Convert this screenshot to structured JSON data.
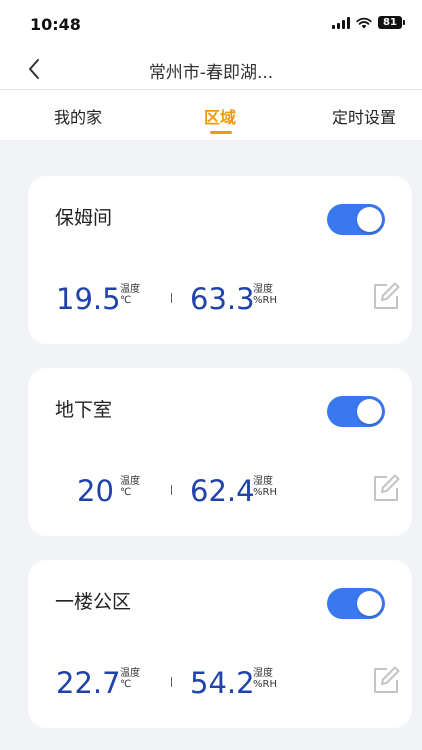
{
  "status_bar": {
    "time": "10:48",
    "battery": "81"
  },
  "nav": {
    "title": "常州市-春即湖..."
  },
  "tabs": [
    {
      "label": "我的家",
      "active": false
    },
    {
      "label": "区域",
      "active": true
    },
    {
      "label": "定时设置",
      "active": false
    }
  ],
  "colors": {
    "accent_orange": "#f29a0e",
    "toggle_blue": "#3a78ef",
    "value_blue": "#1f43a8"
  },
  "rooms": [
    {
      "name": "保姆间",
      "switch_on": true,
      "temperature": "19.5",
      "temp_label": "温度",
      "temp_unit": "℃",
      "humidity": "63.3",
      "hum_label": "湿度",
      "hum_unit": "%RH"
    },
    {
      "name": "地下室",
      "switch_on": true,
      "temperature": "20",
      "temp_label": "温度",
      "temp_unit": "℃",
      "humidity": "62.4",
      "hum_label": "湿度",
      "hum_unit": "%RH"
    },
    {
      "name": "一楼公区",
      "switch_on": true,
      "temperature": "22.7",
      "temp_label": "温度",
      "temp_unit": "℃",
      "humidity": "54.2",
      "hum_label": "湿度",
      "hum_unit": "%RH"
    }
  ]
}
